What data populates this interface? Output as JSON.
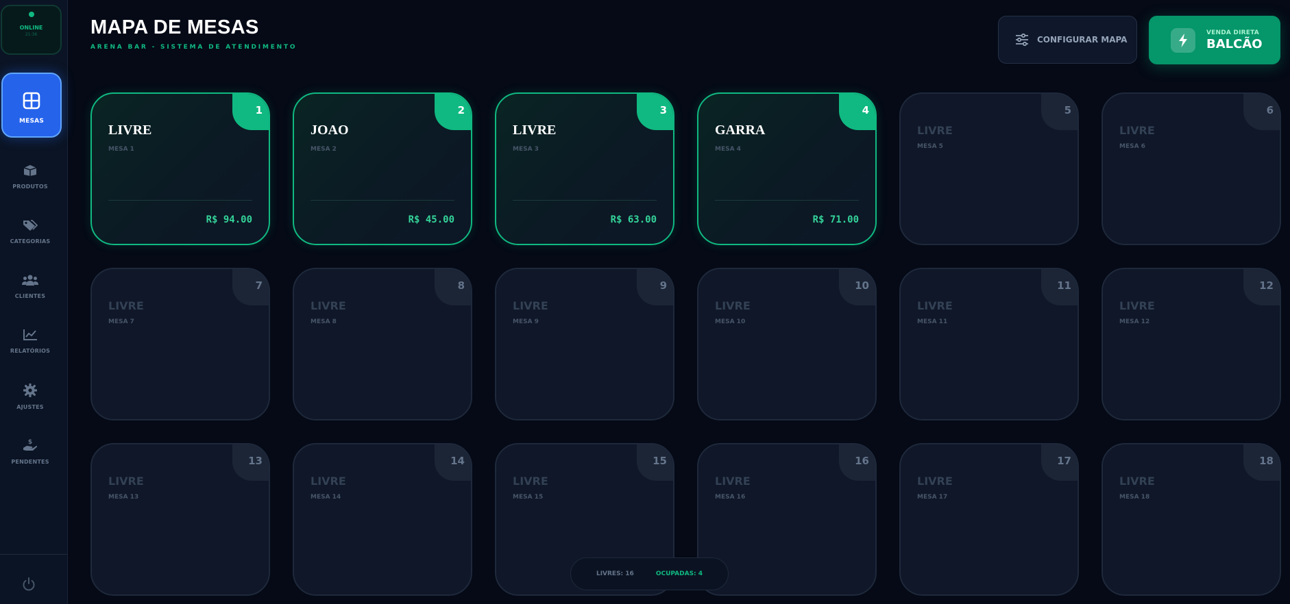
{
  "status": {
    "label": "ONLINE",
    "time": "21:36"
  },
  "nav": {
    "active": {
      "label": "MESAS",
      "icon": "grid-icon"
    },
    "items": [
      {
        "label": "PRODUTOS",
        "icon": "box-icon"
      },
      {
        "label": "CATEGORIAS",
        "icon": "tags-icon"
      },
      {
        "label": "CLIENTES",
        "icon": "users-icon"
      },
      {
        "label": "RELATÓRIOS",
        "icon": "chart-line-icon"
      },
      {
        "label": "AJUSTES",
        "icon": "gear-icon"
      },
      {
        "label": "PENDENTES",
        "icon": "hand-money-icon"
      }
    ],
    "power_icon": "power-icon"
  },
  "header": {
    "title": "MAPA DE MESAS",
    "subtitle": "ARENA BAR - SISTEMA DE ATENDIMENTO",
    "config_button": "CONFIGURAR MAPA",
    "balcao_small": "VENDA DIRETA",
    "balcao_big": "BALCÃO"
  },
  "colors": {
    "accent_green": "#10b981",
    "active_blue": "#2563eb",
    "background": "#050a16"
  },
  "tables": [
    {
      "number": "1",
      "status": "LIVRE",
      "sub": "MESA 1",
      "total": "R$ 94.00",
      "occupied": true
    },
    {
      "number": "2",
      "status": "JOAO",
      "sub": "MESA 2",
      "total": "R$ 45.00",
      "occupied": true
    },
    {
      "number": "3",
      "status": "LIVRE",
      "sub": "MESA 3",
      "total": "R$ 63.00",
      "occupied": true
    },
    {
      "number": "4",
      "status": "GARRA",
      "sub": "MESA 4",
      "total": "R$ 71.00",
      "occupied": true
    },
    {
      "number": "5",
      "status": "LIVRE",
      "sub": "MESA 5",
      "occupied": false
    },
    {
      "number": "6",
      "status": "LIVRE",
      "sub": "MESA 6",
      "occupied": false
    },
    {
      "number": "7",
      "status": "LIVRE",
      "sub": "MESA 7",
      "occupied": false
    },
    {
      "number": "8",
      "status": "LIVRE",
      "sub": "MESA 8",
      "occupied": false
    },
    {
      "number": "9",
      "status": "LIVRE",
      "sub": "MESA 9",
      "occupied": false
    },
    {
      "number": "10",
      "status": "LIVRE",
      "sub": "MESA 10",
      "occupied": false
    },
    {
      "number": "11",
      "status": "LIVRE",
      "sub": "MESA 11",
      "occupied": false
    },
    {
      "number": "12",
      "status": "LIVRE",
      "sub": "MESA 12",
      "occupied": false
    },
    {
      "number": "13",
      "status": "LIVRE",
      "sub": "MESA 13",
      "occupied": false
    },
    {
      "number": "14",
      "status": "LIVRE",
      "sub": "MESA 14",
      "occupied": false
    },
    {
      "number": "15",
      "status": "LIVRE",
      "sub": "MESA 15",
      "occupied": false
    },
    {
      "number": "16",
      "status": "LIVRE",
      "sub": "MESA 16",
      "occupied": false
    },
    {
      "number": "17",
      "status": "LIVRE",
      "sub": "MESA 17",
      "occupied": false
    },
    {
      "number": "18",
      "status": "LIVRE",
      "sub": "MESA 18",
      "occupied": false
    }
  ],
  "summary": {
    "free": "LIVRES: 16",
    "occupied": "OCUPADAS: 4"
  }
}
